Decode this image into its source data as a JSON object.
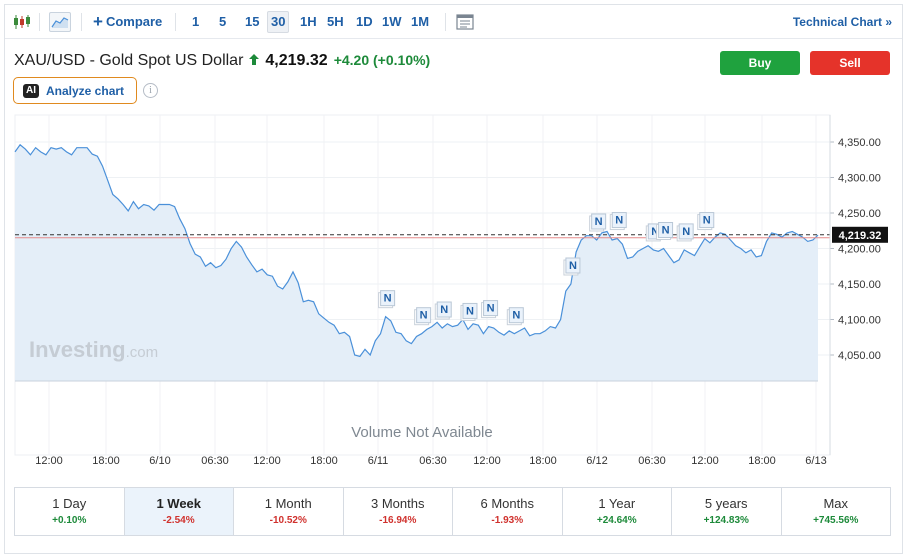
{
  "toolbar": {
    "compare_label": "Compare",
    "intervals": [
      "1",
      "5",
      "15",
      "30",
      "1H",
      "5H",
      "1D",
      "1W",
      "1M"
    ],
    "active_interval": "30",
    "technical_chart_label": "Technical Chart »"
  },
  "instrument": {
    "title": "XAU/USD - Gold Spot US Dollar",
    "last_price": "4,219.32",
    "change": "+4.20",
    "change_pct": "(+0.10%)"
  },
  "actions": {
    "buy_label": "Buy",
    "sell_label": "Sell"
  },
  "analyze": {
    "badge": "AI",
    "label": "Analyze chart",
    "info_glyph": "i"
  },
  "watermark": {
    "brand": "Investing",
    "suffix": ".com"
  },
  "volume_note": "Volume Not Available",
  "colors": {
    "line": "#4a90d9",
    "area": "#e4eef8",
    "up": "#1d8a3a",
    "down": "#d0312d",
    "buy": "#1fa23e",
    "sell": "#e5332a",
    "price_tag": "#111111",
    "accent": "#1f5fa6"
  },
  "chart_data": {
    "type": "area",
    "title": "",
    "xlabel": "",
    "ylabel": "",
    "ylim": [
      4000,
      4375
    ],
    "y_ticks": [
      "4,050.00",
      "4,100.00",
      "4,150.00",
      "4,200.00",
      "4,250.00",
      "4,300.00",
      "4,350.00"
    ],
    "x_ticks": [
      "12:00",
      "18:00",
      "6/10",
      "06:30",
      "12:00",
      "18:00",
      "6/11",
      "06:30",
      "12:00",
      "18:00",
      "6/12",
      "06:30",
      "12:00",
      "18:00",
      "6/13"
    ],
    "current_price": 4219.32,
    "current_price_label": "4,219.32",
    "reference_price": 4215.12,
    "grid": true,
    "series": [
      {
        "values": [
          4336,
          4346,
          4340,
          4332,
          4342,
          4336,
          4332,
          4342,
          4340,
          4342,
          4336,
          4332,
          4342,
          4342,
          4342,
          4333,
          4330,
          4316,
          4296,
          4276,
          4270,
          4262,
          4253,
          4266,
          4256,
          4262,
          4260,
          4254,
          4262,
          4262,
          4262,
          4259,
          4242,
          4228,
          4207,
          4192,
          4188,
          4175,
          4180,
          4173,
          4176,
          4185,
          4200,
          4210,
          4202,
          4188,
          4177,
          4167,
          4171,
          4163,
          4161,
          4147,
          4143,
          4153,
          4167,
          4152,
          4125,
          4127,
          4125,
          4108,
          4102,
          4096,
          4092,
          4080,
          4082,
          4076,
          4050,
          4048,
          4058,
          4050,
          4070,
          4080,
          4104,
          4098,
          4082,
          4080,
          4070,
          4066,
          4076,
          4080,
          4086,
          4090,
          4096,
          4088,
          4094,
          4090,
          4092,
          4100,
          4086,
          4094,
          4092,
          4080,
          4090,
          4088,
          4082,
          4078,
          4084,
          4080,
          4084,
          4088,
          4077,
          4080,
          4080,
          4084,
          4090,
          4088,
          4100,
          4140,
          4150,
          4195,
          4212,
          4218,
          4218,
          4212,
          4222,
          4224,
          4212,
          4214,
          4206,
          4186,
          4188,
          4196,
          4200,
          4204,
          4198,
          4196,
          4200,
          4190,
          4180,
          4184,
          4198,
          4194,
          4190,
          4202,
          4214,
          4208,
          4216,
          4222,
          4220,
          4212,
          4204,
          4200,
          4194,
          4198,
          4188,
          4190,
          4210,
          4222,
          4220,
          4216,
          4222,
          4224,
          4220,
          4216,
          4210,
          4212,
          4219
        ]
      }
    ],
    "news_markers": [
      {
        "label": "N",
        "index": 72
      },
      {
        "label": "N",
        "index": 79
      },
      {
        "label": "N",
        "index": 83
      },
      {
        "label": "N",
        "index": 88
      },
      {
        "label": "N",
        "index": 92
      },
      {
        "label": "N",
        "index": 97
      },
      {
        "label": "N",
        "index": 108
      },
      {
        "label": "N",
        "index": 113
      },
      {
        "label": "N",
        "index": 117
      },
      {
        "label": "N",
        "index": 124
      },
      {
        "label": "N",
        "index": 126
      },
      {
        "label": "N",
        "index": 130
      },
      {
        "label": "N",
        "index": 134
      }
    ]
  },
  "periods": [
    {
      "label": "1 Day",
      "change": "+0.10%",
      "dir": "pos"
    },
    {
      "label": "1 Week",
      "change": "-2.54%",
      "dir": "neg",
      "active": true
    },
    {
      "label": "1 Month",
      "change": "-10.52%",
      "dir": "neg"
    },
    {
      "label": "3 Months",
      "change": "-16.94%",
      "dir": "neg"
    },
    {
      "label": "6 Months",
      "change": "-1.93%",
      "dir": "neg"
    },
    {
      "label": "1 Year",
      "change": "+24.64%",
      "dir": "pos"
    },
    {
      "label": "5 years",
      "change": "+124.83%",
      "dir": "pos"
    },
    {
      "label": "Max",
      "change": "+745.56%",
      "dir": "pos"
    }
  ]
}
